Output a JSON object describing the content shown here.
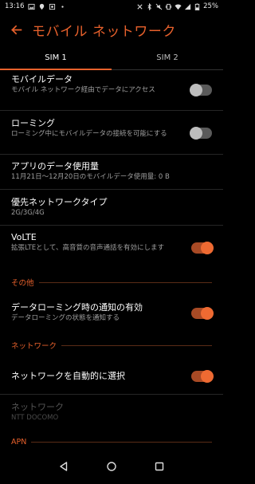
{
  "status_bar": {
    "time": "13:16",
    "battery": "25%",
    "left_icons": [
      "gallery-icon",
      "location-icon",
      "photo-icon",
      "dot-icon"
    ],
    "right_icons": [
      "close-x-icon",
      "bluetooth-icon",
      "mute-icon",
      "vibrate-icon",
      "wifi-icon",
      "signal-icon",
      "battery-icon"
    ]
  },
  "header": {
    "title": "モバイル ネットワーク"
  },
  "tabs": [
    {
      "label": "SIM 1",
      "active": true
    },
    {
      "label": "SIM 2",
      "active": false
    }
  ],
  "settings": {
    "mobile_data": {
      "title": "モバイルデータ",
      "subtitle": "モバイル ネットワーク経由でデータにアクセス",
      "enabled": false
    },
    "roaming": {
      "title": "ローミング",
      "subtitle": "ローミング中にモバイルデータの接続を可能にする",
      "enabled": false
    },
    "app_data_usage": {
      "title": "アプリのデータ使用量",
      "subtitle": "11月21日〜12月20日のモバイルデータ使用量: 0 B"
    },
    "preferred_network": {
      "title": "優先ネットワークタイプ",
      "subtitle": "2G/3G/4G"
    },
    "volte": {
      "title": "VoLTE",
      "subtitle": "拡張LTEとして、高音質の音声通話を有効にします",
      "enabled": true
    }
  },
  "sections": {
    "other": "その他",
    "network": "ネットワーク",
    "apn": "APN"
  },
  "other_settings": {
    "roaming_notify": {
      "title": "データローミング時の通知の有効",
      "subtitle": "データローミングの状態を通知する",
      "enabled": true
    }
  },
  "network_settings": {
    "auto_select": {
      "title": "ネットワークを自動的に選択",
      "enabled": true
    },
    "network": {
      "title": "ネットワーク",
      "subtitle": "NTT DOCOMO"
    }
  },
  "colors": {
    "accent": "#e8612c",
    "background": "#000000"
  }
}
